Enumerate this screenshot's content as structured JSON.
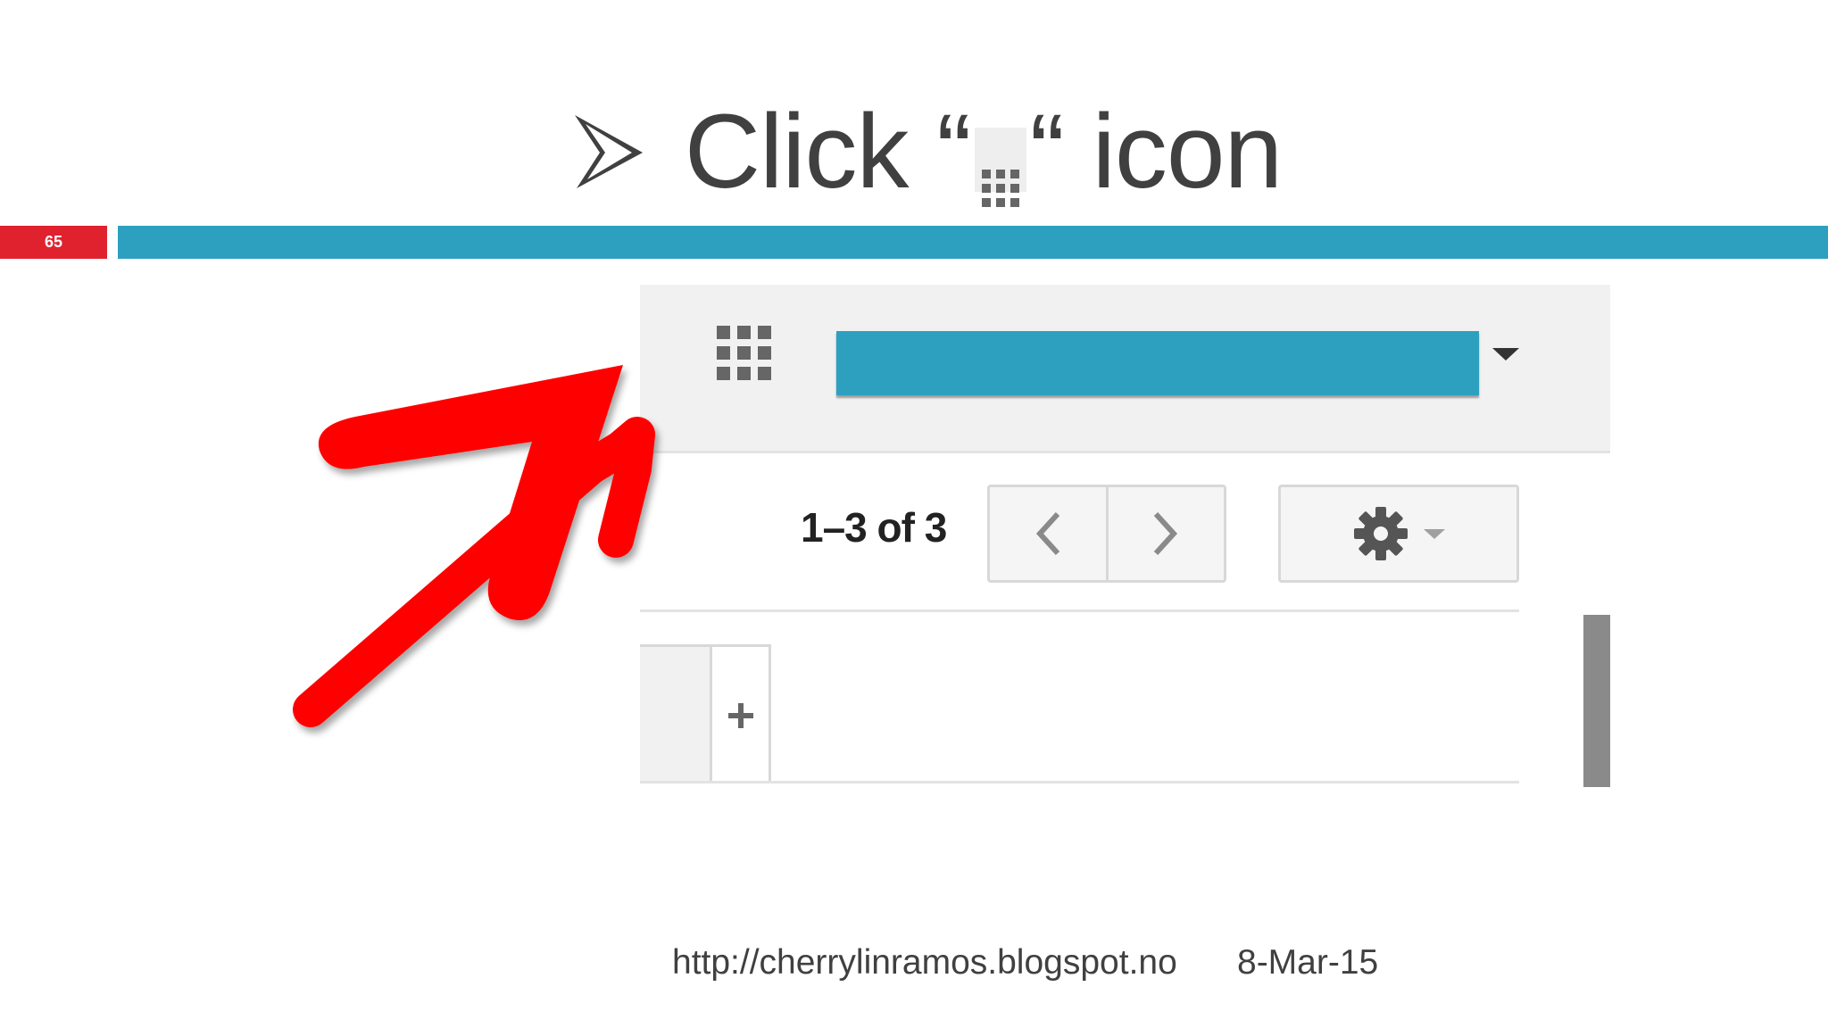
{
  "slide": {
    "number": "65",
    "title": {
      "prefix": "Click “",
      "suffix": "“ icon",
      "bullet_icon": "arrowhead-bullet-icon",
      "inline_icon": "apps-grid-icon"
    },
    "footer": {
      "url": "http://cherrylinramos.blogspot.no",
      "date": "8-Mar-15"
    }
  },
  "screenshot": {
    "header": {
      "apps_icon": "apps-grid-icon",
      "account_bar_color": "#2da0c0",
      "account_caret_icon": "caret-down-icon"
    },
    "toolbar": {
      "count_text": "1–3 of 3",
      "prev_icon": "chevron-left-icon",
      "next_icon": "chevron-right-icon",
      "settings_icon": "gear-icon",
      "settings_caret_icon": "caret-down-icon"
    },
    "list": {
      "add_icon": "plus-icon"
    }
  },
  "annotation": {
    "arrow_icon": "red-pointer-arrow-icon",
    "arrow_color": "#ff0000"
  },
  "colors": {
    "accent": "#2da0c0",
    "slide_number_bg": "#e0222e",
    "title_text": "#404040"
  }
}
